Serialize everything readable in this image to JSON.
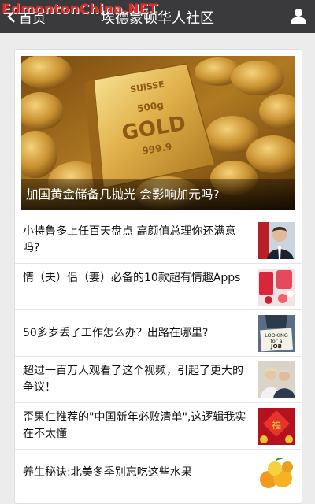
{
  "watermark": "EdmontonChina.NET",
  "topbar": {
    "back_label": "首页",
    "title": "埃德蒙顿华人社区",
    "back_icon": "chevron-left-icon",
    "profile_icon": "person-icon"
  },
  "hero": {
    "caption": "加国黄金储备几抛光 会影响加元吗?",
    "bar_text": [
      "SUISSE",
      "500g",
      "GOLD",
      "999.9"
    ]
  },
  "articles": [
    {
      "title": "小特鲁多上任百天盘点 高颜值总理你还满意吗?"
    },
    {
      "title": "情（夫）侣（妻）必备的10款超有情趣Apps"
    },
    {
      "title": "50多岁丢了工作怎么办？出路在哪里?",
      "thumb_text": [
        "LOOKING",
        "for a",
        "JOB"
      ]
    },
    {
      "title": "超过一百万人观看了这个视频，引起了更大的争议！"
    },
    {
      "title": "歪果仁推荐的\"中国新年必败清单\",这逻辑我实在不太懂",
      "thumb_text": [
        "福"
      ]
    },
    {
      "title": "养生秘诀:北美冬季别忘吃这些水果"
    }
  ]
}
